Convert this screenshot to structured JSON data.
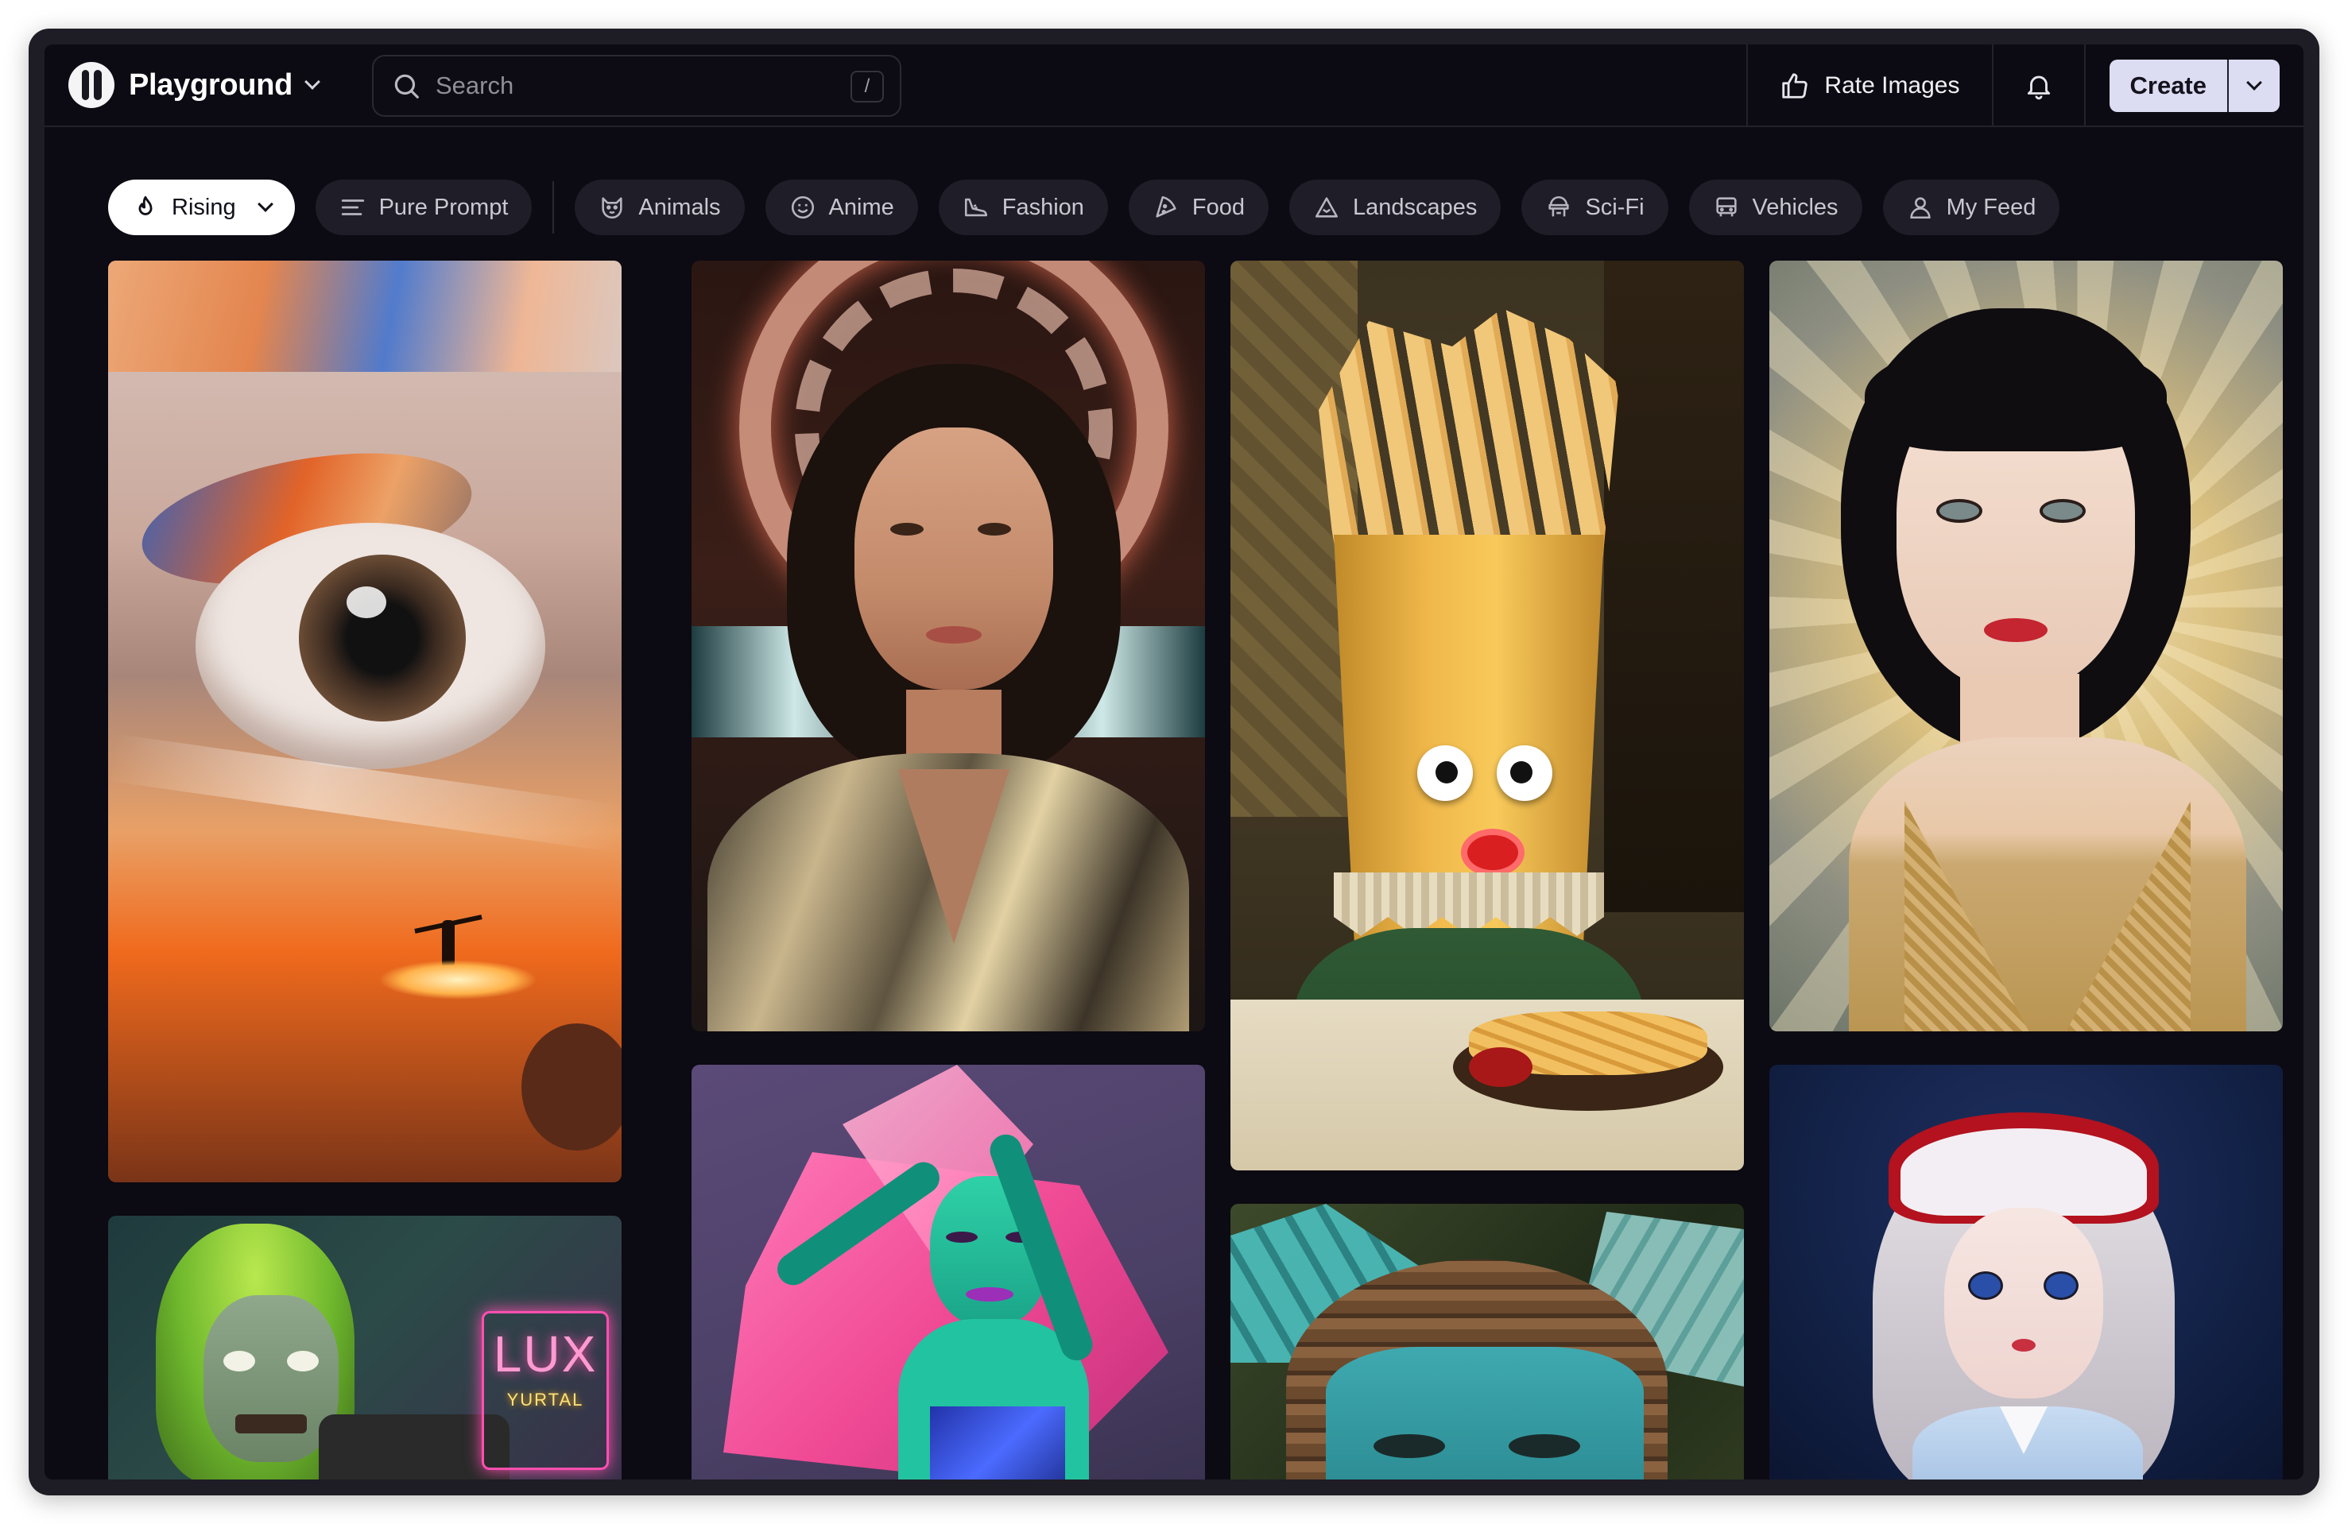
{
  "header": {
    "brand": "Playground",
    "search_placeholder": "Search",
    "search_shortcut": "/",
    "rate_label": "Rate Images",
    "create_label": "Create"
  },
  "filters": [
    {
      "label": "Rising",
      "icon": "flame-icon",
      "active": true
    },
    {
      "label": "Pure Prompt",
      "icon": "lines-icon"
    },
    {
      "label": "Animals",
      "icon": "cat-icon"
    },
    {
      "label": "Anime",
      "icon": "smile-icon"
    },
    {
      "label": "Fashion",
      "icon": "shoe-icon"
    },
    {
      "label": "Food",
      "icon": "pizza-icon"
    },
    {
      "label": "Landscapes",
      "icon": "mountain-icon"
    },
    {
      "label": "Sci-Fi",
      "icon": "robot-icon"
    },
    {
      "label": "Vehicles",
      "icon": "car-icon"
    },
    {
      "label": "My Feed",
      "icon": "user-icon"
    }
  ],
  "gallery": {
    "neon_sign_text_1": "LUX",
    "neon_sign_text_2": "YURTAL"
  },
  "colors": {
    "background": "#0c0a12",
    "pill": "#1f1d27",
    "active_pill": "#ffffff",
    "create_button": "#dcdcf3"
  }
}
